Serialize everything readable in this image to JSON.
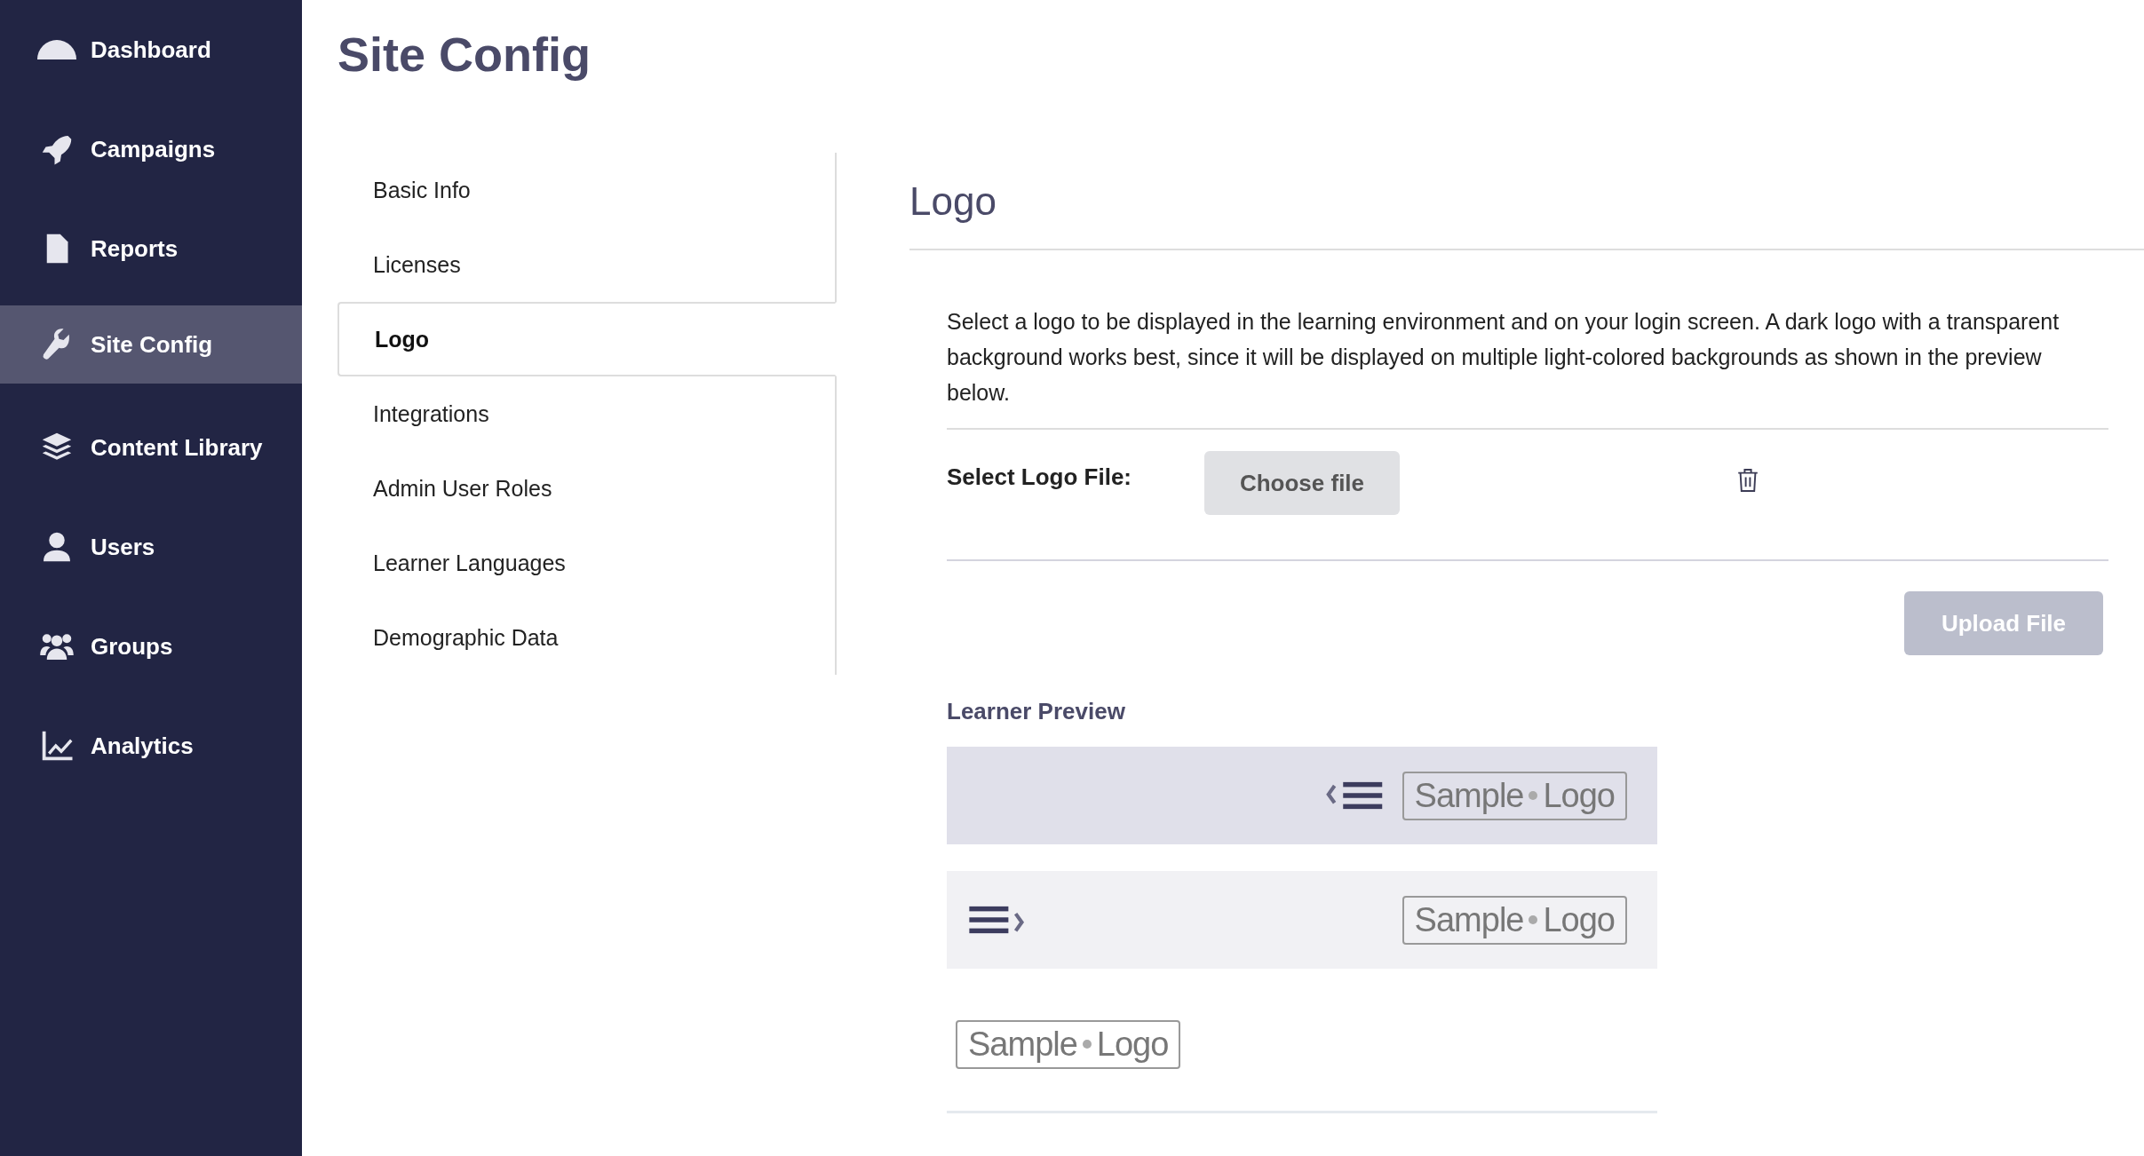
{
  "sidebar": {
    "items": [
      {
        "label": "Dashboard",
        "selected": false
      },
      {
        "label": "Campaigns",
        "selected": false
      },
      {
        "label": "Reports",
        "selected": false
      },
      {
        "label": "Site Config",
        "selected": true
      },
      {
        "label": "Content Library",
        "selected": false
      },
      {
        "label": "Users",
        "selected": false
      },
      {
        "label": "Groups",
        "selected": false
      },
      {
        "label": "Analytics",
        "selected": false
      }
    ]
  },
  "page_title": "Site Config",
  "subnav": {
    "items": [
      {
        "label": "Basic Info",
        "selected": false
      },
      {
        "label": "Licenses",
        "selected": false
      },
      {
        "label": "Logo",
        "selected": true
      },
      {
        "label": "Integrations",
        "selected": false
      },
      {
        "label": "Admin User Roles",
        "selected": false
      },
      {
        "label": "Learner Languages",
        "selected": false
      },
      {
        "label": "Demographic Data",
        "selected": false
      }
    ]
  },
  "section": {
    "title": "Logo",
    "description": "Select a logo to be displayed in the learning environment and on your login screen. A dark logo with a transparent background works best, since it will be displayed on multiple light-colored backgrounds as shown in the preview below.",
    "file_label": "Select Logo File:",
    "choose_button": "Choose file",
    "upload_button": {
      "label": "Upload File",
      "disabled": true
    },
    "preview_title": "Learner Preview",
    "previews": [
      {
        "kind": "menu-open",
        "logo": [
          "Sample",
          "Logo"
        ]
      },
      {
        "kind": "menu-closed",
        "logo": [
          "Sample",
          "Logo"
        ]
      },
      {
        "kind": "plain",
        "logo": [
          "Sample",
          "Logo"
        ]
      }
    ]
  }
}
